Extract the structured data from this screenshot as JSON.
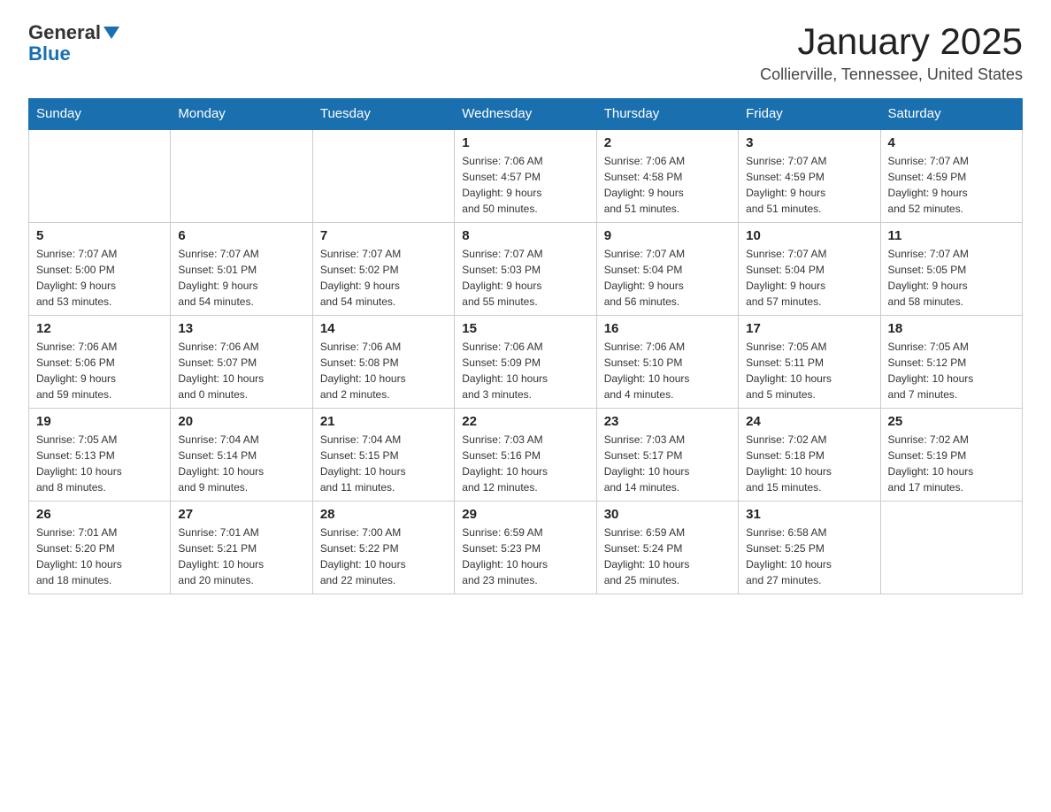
{
  "header": {
    "logo_general": "General",
    "logo_blue": "Blue",
    "month_title": "January 2025",
    "location": "Collierville, Tennessee, United States"
  },
  "days_of_week": [
    "Sunday",
    "Monday",
    "Tuesday",
    "Wednesday",
    "Thursday",
    "Friday",
    "Saturday"
  ],
  "weeks": [
    [
      {
        "day": "",
        "info": ""
      },
      {
        "day": "",
        "info": ""
      },
      {
        "day": "",
        "info": ""
      },
      {
        "day": "1",
        "info": "Sunrise: 7:06 AM\nSunset: 4:57 PM\nDaylight: 9 hours\nand 50 minutes."
      },
      {
        "day": "2",
        "info": "Sunrise: 7:06 AM\nSunset: 4:58 PM\nDaylight: 9 hours\nand 51 minutes."
      },
      {
        "day": "3",
        "info": "Sunrise: 7:07 AM\nSunset: 4:59 PM\nDaylight: 9 hours\nand 51 minutes."
      },
      {
        "day": "4",
        "info": "Sunrise: 7:07 AM\nSunset: 4:59 PM\nDaylight: 9 hours\nand 52 minutes."
      }
    ],
    [
      {
        "day": "5",
        "info": "Sunrise: 7:07 AM\nSunset: 5:00 PM\nDaylight: 9 hours\nand 53 minutes."
      },
      {
        "day": "6",
        "info": "Sunrise: 7:07 AM\nSunset: 5:01 PM\nDaylight: 9 hours\nand 54 minutes."
      },
      {
        "day": "7",
        "info": "Sunrise: 7:07 AM\nSunset: 5:02 PM\nDaylight: 9 hours\nand 54 minutes."
      },
      {
        "day": "8",
        "info": "Sunrise: 7:07 AM\nSunset: 5:03 PM\nDaylight: 9 hours\nand 55 minutes."
      },
      {
        "day": "9",
        "info": "Sunrise: 7:07 AM\nSunset: 5:04 PM\nDaylight: 9 hours\nand 56 minutes."
      },
      {
        "day": "10",
        "info": "Sunrise: 7:07 AM\nSunset: 5:04 PM\nDaylight: 9 hours\nand 57 minutes."
      },
      {
        "day": "11",
        "info": "Sunrise: 7:07 AM\nSunset: 5:05 PM\nDaylight: 9 hours\nand 58 minutes."
      }
    ],
    [
      {
        "day": "12",
        "info": "Sunrise: 7:06 AM\nSunset: 5:06 PM\nDaylight: 9 hours\nand 59 minutes."
      },
      {
        "day": "13",
        "info": "Sunrise: 7:06 AM\nSunset: 5:07 PM\nDaylight: 10 hours\nand 0 minutes."
      },
      {
        "day": "14",
        "info": "Sunrise: 7:06 AM\nSunset: 5:08 PM\nDaylight: 10 hours\nand 2 minutes."
      },
      {
        "day": "15",
        "info": "Sunrise: 7:06 AM\nSunset: 5:09 PM\nDaylight: 10 hours\nand 3 minutes."
      },
      {
        "day": "16",
        "info": "Sunrise: 7:06 AM\nSunset: 5:10 PM\nDaylight: 10 hours\nand 4 minutes."
      },
      {
        "day": "17",
        "info": "Sunrise: 7:05 AM\nSunset: 5:11 PM\nDaylight: 10 hours\nand 5 minutes."
      },
      {
        "day": "18",
        "info": "Sunrise: 7:05 AM\nSunset: 5:12 PM\nDaylight: 10 hours\nand 7 minutes."
      }
    ],
    [
      {
        "day": "19",
        "info": "Sunrise: 7:05 AM\nSunset: 5:13 PM\nDaylight: 10 hours\nand 8 minutes."
      },
      {
        "day": "20",
        "info": "Sunrise: 7:04 AM\nSunset: 5:14 PM\nDaylight: 10 hours\nand 9 minutes."
      },
      {
        "day": "21",
        "info": "Sunrise: 7:04 AM\nSunset: 5:15 PM\nDaylight: 10 hours\nand 11 minutes."
      },
      {
        "day": "22",
        "info": "Sunrise: 7:03 AM\nSunset: 5:16 PM\nDaylight: 10 hours\nand 12 minutes."
      },
      {
        "day": "23",
        "info": "Sunrise: 7:03 AM\nSunset: 5:17 PM\nDaylight: 10 hours\nand 14 minutes."
      },
      {
        "day": "24",
        "info": "Sunrise: 7:02 AM\nSunset: 5:18 PM\nDaylight: 10 hours\nand 15 minutes."
      },
      {
        "day": "25",
        "info": "Sunrise: 7:02 AM\nSunset: 5:19 PM\nDaylight: 10 hours\nand 17 minutes."
      }
    ],
    [
      {
        "day": "26",
        "info": "Sunrise: 7:01 AM\nSunset: 5:20 PM\nDaylight: 10 hours\nand 18 minutes."
      },
      {
        "day": "27",
        "info": "Sunrise: 7:01 AM\nSunset: 5:21 PM\nDaylight: 10 hours\nand 20 minutes."
      },
      {
        "day": "28",
        "info": "Sunrise: 7:00 AM\nSunset: 5:22 PM\nDaylight: 10 hours\nand 22 minutes."
      },
      {
        "day": "29",
        "info": "Sunrise: 6:59 AM\nSunset: 5:23 PM\nDaylight: 10 hours\nand 23 minutes."
      },
      {
        "day": "30",
        "info": "Sunrise: 6:59 AM\nSunset: 5:24 PM\nDaylight: 10 hours\nand 25 minutes."
      },
      {
        "day": "31",
        "info": "Sunrise: 6:58 AM\nSunset: 5:25 PM\nDaylight: 10 hours\nand 27 minutes."
      },
      {
        "day": "",
        "info": ""
      }
    ]
  ]
}
